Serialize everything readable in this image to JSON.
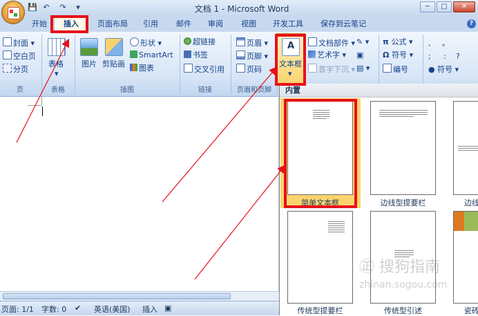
{
  "window": {
    "title": "文档 1 - Microsoft Word",
    "min": "−",
    "max": "□",
    "close": "✕"
  },
  "quick_access": [
    "💾",
    "↶",
    "↷",
    "▾"
  ],
  "tabs": [
    "开始",
    "插入",
    "页面布局",
    "引用",
    "邮件",
    "审阅",
    "视图",
    "开发工具",
    "保存到云笔记"
  ],
  "help": "?",
  "ribbon": {
    "page": {
      "items": [
        "封面",
        "空白页",
        "分页"
      ],
      "label": "页"
    },
    "table": {
      "button": "表格",
      "label": "表格"
    },
    "illustrations": {
      "items": [
        "图片",
        "剪贴画",
        "形状",
        "SmartArt",
        "图表"
      ],
      "label": "插图"
    },
    "links": {
      "items": [
        "超链接",
        "书签",
        "交叉引用"
      ],
      "label": "链接"
    },
    "header_footer": {
      "items": [
        "页眉",
        "页脚",
        "页码"
      ],
      "label": "页眉和页脚"
    },
    "text": {
      "textbox": "文本框",
      "items": [
        "文档部件",
        "艺术字",
        "首字下沉"
      ]
    },
    "symbols": {
      "items": [
        "公式",
        "符号",
        "编号",
        "符号"
      ],
      "punct": [
        ",",
        "。",
        ";",
        ":",
        "?"
      ]
    }
  },
  "gallery": {
    "header": "内置",
    "items": [
      "简单文本框",
      "边线型提要栏",
      "边线",
      "传统型提要栏",
      "传统型引述",
      "瓷砖"
    ]
  },
  "watermark": {
    "line1": "㊣ 搜狗指南",
    "line2": "zhinan.sogou.com"
  },
  "status": {
    "page": "页面: 1/1",
    "words": "字数: 0",
    "lang": "英语(美国)",
    "mode": "插入"
  },
  "colors": {
    "highlight": "#e8101a",
    "accent": "#15428b",
    "selected": "#fbd46e"
  }
}
